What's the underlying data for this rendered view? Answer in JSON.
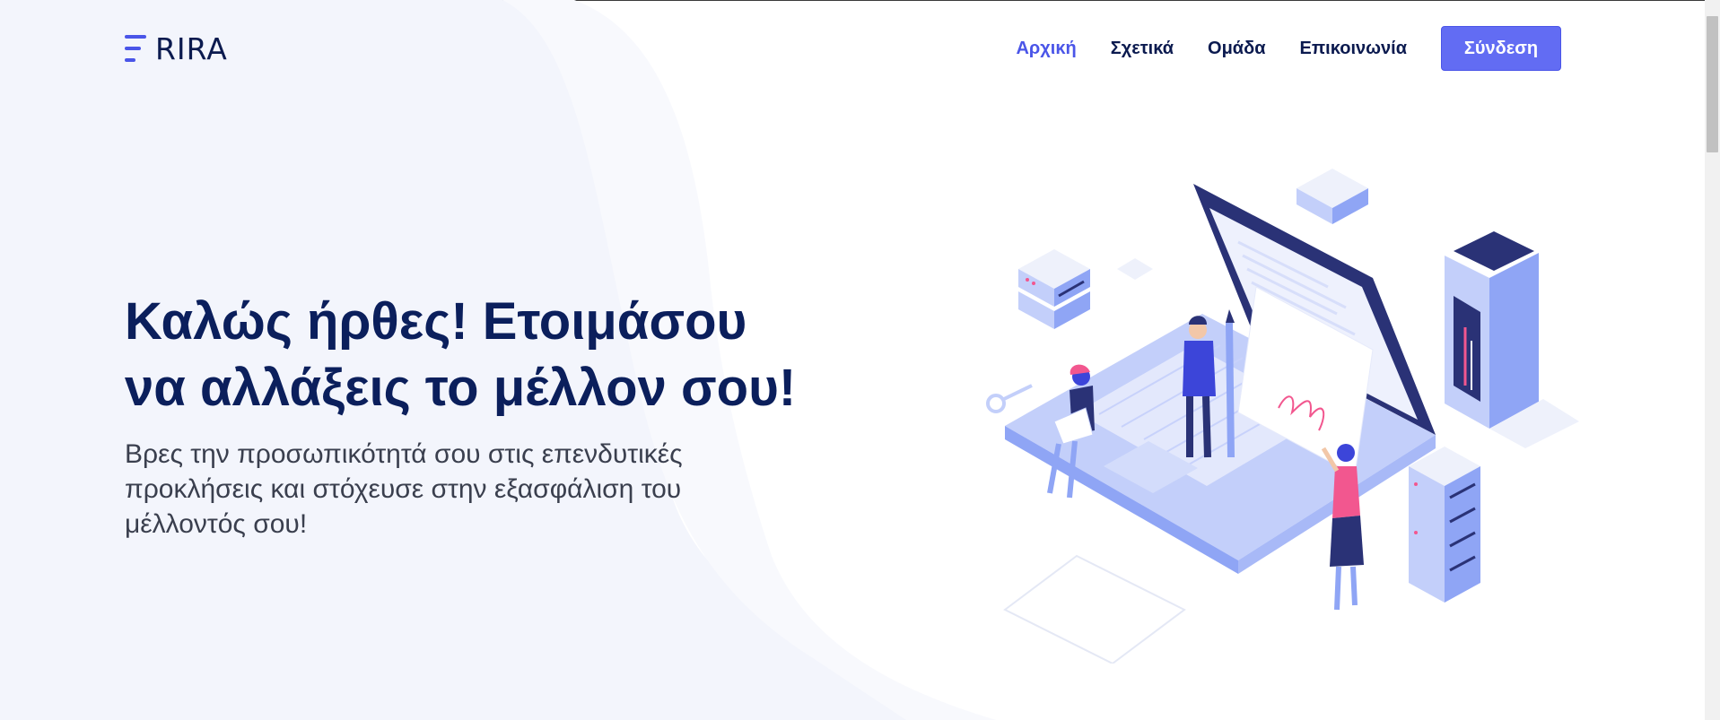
{
  "brand": {
    "name": "RIRA",
    "accent": "#4a55e8"
  },
  "nav": {
    "items": [
      {
        "label": "Αρχική",
        "active": true
      },
      {
        "label": "Σχετικά",
        "active": false
      },
      {
        "label": "Ομάδα",
        "active": false
      },
      {
        "label": "Επικοινωνία",
        "active": false
      }
    ],
    "login_label": "Σύνδεση"
  },
  "hero": {
    "title_line1": "Καλώς ήρθες! Ετοιμάσου",
    "title_line2": "να αλλάξεις το μέλλον σου!",
    "subtitle": "Βρες την προσωπικότητά σου στις επενδυτικές προκλήσεις και στόχευσε στην εξασφάλιση του μέλλοντός σου!"
  },
  "illustration": {
    "icon": "isometric-laptop-people-illustration"
  },
  "colors": {
    "title": "#0b1f5c",
    "subtitle": "#3a3f4e",
    "button": "#626cf3",
    "pink": "#f2578f",
    "navy": "#2a3276",
    "periwinkle": "#8fa5f5"
  }
}
